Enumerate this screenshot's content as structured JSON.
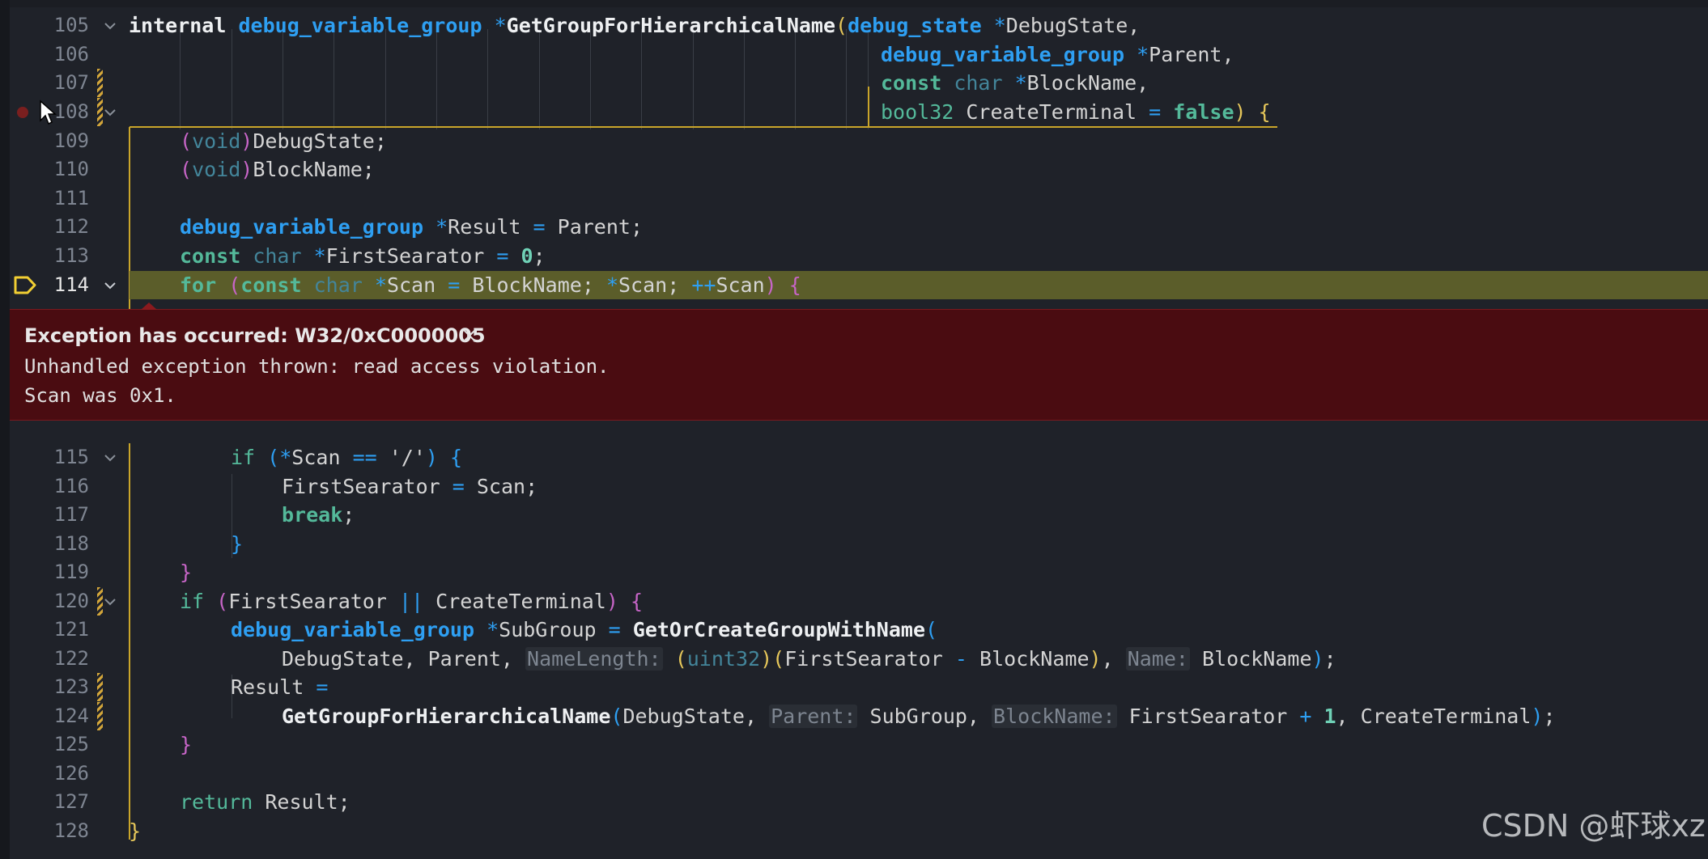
{
  "line_numbers": [
    "105",
    "106",
    "107",
    "108",
    "109",
    "110",
    "111",
    "112",
    "113",
    "114",
    "115",
    "116",
    "117",
    "118",
    "119",
    "120",
    "121",
    "122",
    "123",
    "124",
    "125",
    "126",
    "127",
    "128"
  ],
  "code": {
    "l105": {
      "t1": "internal",
      "t2": "debug_variable_group",
      "t3": "*",
      "t4": "GetGroupForHierarchicalName",
      "t5": "(",
      "t6": "debug_state",
      "t7": "*",
      "t8": "DebugState,"
    },
    "l106": {
      "t1": "debug_variable_group",
      "t2": "*",
      "t3": "Parent,"
    },
    "l107": {
      "t1": "const",
      "t2": "char",
      "t3": "*",
      "t4": "BlockName,"
    },
    "l108": {
      "t1": "bool32",
      "t2": "CreateTerminal",
      "t3": "=",
      "t4": "false",
      "t5": ")",
      "t6": "{"
    },
    "l109": {
      "t1": "(",
      "t2": "void",
      "t3": ")",
      "t4": "DebugState;"
    },
    "l110": {
      "t1": "(",
      "t2": "void",
      "t3": ")",
      "t4": "BlockName;"
    },
    "l112": {
      "t1": "debug_variable_group",
      "t2": "*",
      "t3": "Result",
      "t4": "=",
      "t5": "Parent;"
    },
    "l113": {
      "t1": "const",
      "t2": "char",
      "t3": "*",
      "t4": "FirstSearator",
      "t5": "=",
      "t6": "0",
      "t7": ";"
    },
    "l114": {
      "t1": "for",
      "t2": "(",
      "t3": "const",
      "t4": "char",
      "t5": "*",
      "t6": "Scan",
      "t7": "=",
      "t8": "BlockName;",
      "t9": "*",
      "t10": "Scan;",
      "t11": "++",
      "t12": "Scan",
      ")": ")",
      "t13": ")",
      "t14": "{"
    },
    "l115": {
      "t1": "if",
      "t2": "(",
      "t3": "*",
      "t4": "Scan",
      "t5": "==",
      "t6": "'/'",
      "t7": ")",
      "t8": "{"
    },
    "l116": {
      "t1": "FirstSearator",
      "t2": "=",
      "t3": "Scan;"
    },
    "l117": {
      "t1": "break",
      "t2": ";"
    },
    "l118": {
      "t1": "}"
    },
    "l119": {
      "t1": "}"
    },
    "l120": {
      "t1": "if",
      "t2": "(",
      "t3": "FirstSearator",
      "t4": "||",
      "t5": "CreateTerminal",
      ")": ")",
      "t6": ")",
      "t7": "{"
    },
    "l121": {
      "t1": "debug_variable_group",
      "t2": "*",
      "t3": "SubGroup",
      "t4": "=",
      "t5": "GetOrCreateGroupWithName",
      "t6": "("
    },
    "l122": {
      "t1": "DebugState, Parent,",
      "h1": "NameLength:",
      "t2": "(",
      "t3": "uint32",
      "t4": ")",
      "t5": "(",
      "t6": "FirstSearator",
      "t7": "-",
      "t8": "BlockName",
      "t9": ")",
      ",": ",",
      "t10": ",",
      "h2": "Name:",
      "t11": "BlockName",
      "t12": ")",
      "t13": ";"
    },
    "l123": {
      "t1": "Result",
      "t2": "="
    },
    "l124": {
      "t1": "GetGroupForHierarchicalName",
      "t2": "(",
      "t3": "DebugState,",
      "h1": "Parent:",
      "t4": "SubGroup,",
      "h2": "BlockName:",
      "t5": "FirstSearator",
      "t6": "+",
      "t7": "1",
      ",": ",",
      "t8": ",",
      "t9": "CreateTerminal",
      "t10": ")",
      "t11": ";"
    },
    "l125": {
      "t1": "}"
    },
    "l127": {
      "t1": "return",
      "t2": "Result;"
    },
    "l128": {
      "t1": "}"
    }
  },
  "exception": {
    "title": "Exception has occurred: W32/0xC0000005",
    "message_line1": "Unhandled exception thrown: read access violation.",
    "message_line2": "Scan was 0x1."
  },
  "watermark": "CSDN @虾球xz",
  "icons": {
    "close": "close-icon",
    "fold": "chevron-down-icon",
    "breakpoint": "breakpoint-dot-icon",
    "current_line": "execution-pointer-icon",
    "mouse": "mouse-cursor-icon"
  },
  "colors": {
    "background": "#1f2229",
    "highlight_line": "#5b5d2a",
    "exception_bg": "#4a0c11",
    "keyword": "#54b99a",
    "type": "#2e9ff2"
  }
}
